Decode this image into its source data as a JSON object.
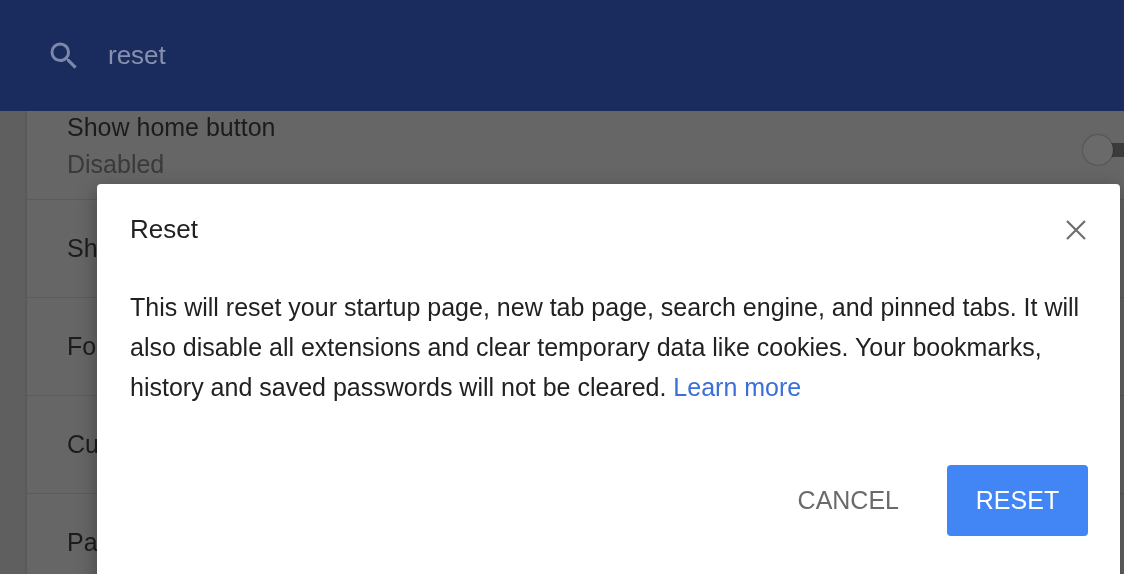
{
  "header": {
    "search": {
      "value": "reset"
    }
  },
  "settings": [
    {
      "label": "Show home button",
      "sublabel": "Disabled",
      "toggle": {
        "on": false
      }
    },
    {
      "label": "Sh"
    },
    {
      "label": "Fo"
    },
    {
      "label": "Cu"
    },
    {
      "label": "Pa"
    }
  ],
  "dialog": {
    "title": "Reset",
    "body": "This will reset your startup page, new tab page, search engine, and pinned tabs. It will also disable all extensions and clear temporary data like cookies. Your bookmarks, history and saved passwords will not be cleared.",
    "link": "Learn more",
    "buttons": [
      {
        "label": "CANCEL",
        "kind": "text"
      },
      {
        "label": "RESET",
        "kind": "primary"
      }
    ]
  }
}
